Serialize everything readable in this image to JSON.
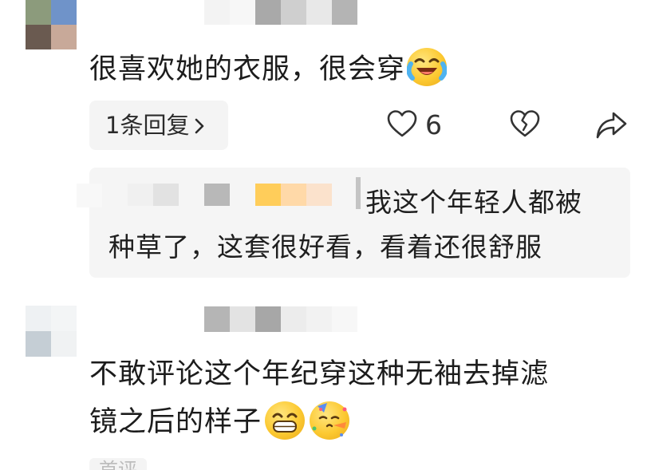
{
  "comments": [
    {
      "text": "很喜欢她的衣服，很会穿",
      "emoji": "laughing-crying-emoji",
      "reply_count_label": "1条回复",
      "like_count": "6"
    },
    {
      "text_line1": "不敢评论这个年纪穿这种无袖去掉滤",
      "text_line2": "镜之后的样子",
      "emojis": [
        "grinning-emoji",
        "party-emoji"
      ]
    }
  ],
  "reply": {
    "line1": "我这个年轻人都被",
    "line2": "种草了，这套很好看，看着还很舒服"
  },
  "more_label": "首评"
}
